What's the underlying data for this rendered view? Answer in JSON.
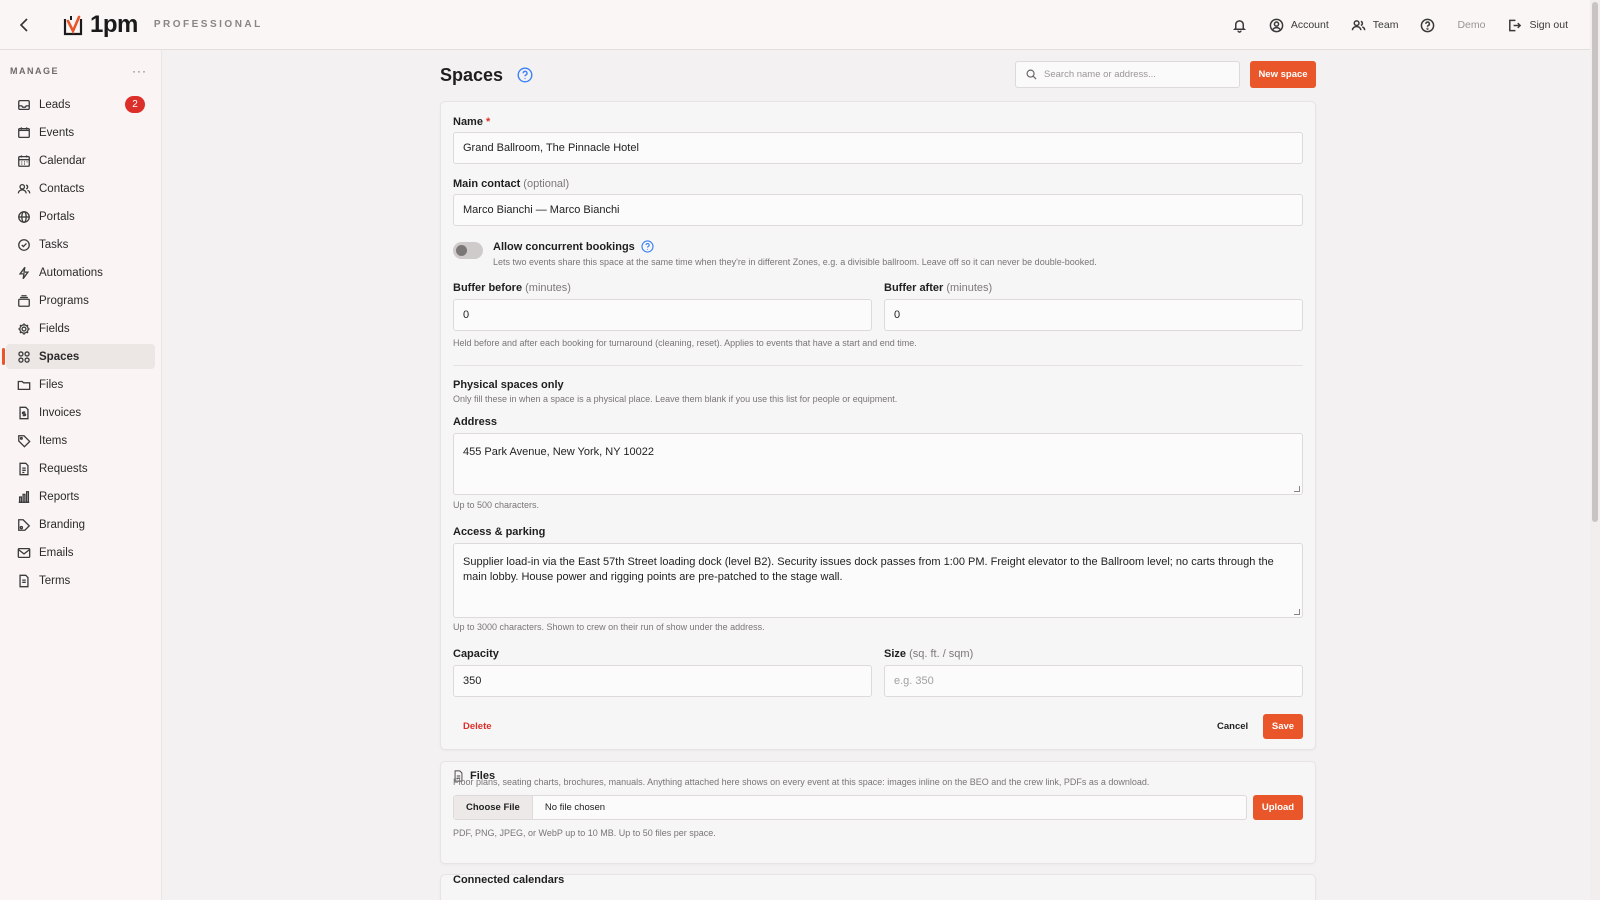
{
  "app": {
    "brand": "1pm",
    "tier": "PROFESSIONAL"
  },
  "topnav": {
    "account": "Account",
    "team": "Team",
    "demo": "Demo",
    "sign_out": "Sign out"
  },
  "sidebar": {
    "section": "MANAGE",
    "more": "···",
    "items": [
      {
        "label": "Leads",
        "icon": "inbox-icon",
        "badge": "2"
      },
      {
        "label": "Events",
        "icon": "mail-icon"
      },
      {
        "label": "Calendar",
        "icon": "calendar-icon"
      },
      {
        "label": "Contacts",
        "icon": "users-icon"
      },
      {
        "label": "Portals",
        "icon": "globe-icon"
      },
      {
        "label": "Tasks",
        "icon": "check-circle-icon"
      },
      {
        "label": "Automations",
        "icon": "bolt-icon"
      },
      {
        "label": "Programs",
        "icon": "layers-icon"
      },
      {
        "label": "Fields",
        "icon": "gear-icon"
      },
      {
        "label": "Spaces",
        "icon": "grid-icon",
        "active": true
      },
      {
        "label": "Files",
        "icon": "folder-icon"
      },
      {
        "label": "Invoices",
        "icon": "invoice-icon"
      },
      {
        "label": "Items",
        "icon": "tag-icon"
      },
      {
        "label": "Requests",
        "icon": "document-icon"
      },
      {
        "label": "Reports",
        "icon": "bar-chart-icon"
      },
      {
        "label": "Branding",
        "icon": "brush-icon"
      },
      {
        "label": "Emails",
        "icon": "envelope-icon"
      },
      {
        "label": "Terms",
        "icon": "file-text-icon"
      }
    ]
  },
  "page": {
    "title": "Spaces",
    "search_placeholder": "Search name or address...",
    "new_space": "New space"
  },
  "form": {
    "name_label": "Name",
    "required_mark": "*",
    "name_value": "Grand Ballroom, The Pinnacle Hotel",
    "contact_label": "Main contact",
    "contact_optional": "(optional)",
    "contact_value": "Marco Bianchi — Marco Bianchi",
    "concurrent_label": "Allow concurrent bookings",
    "concurrent_on": false,
    "concurrent_hint": "Lets two events share this space at the same time when they're in different Zones, e.g. a divisible ballroom. Leave off so it can never be double-booked.",
    "buffer_before_label": "Buffer before",
    "buffer_before_unit": "(minutes)",
    "buffer_before_value": "0",
    "buffer_after_label": "Buffer after",
    "buffer_after_unit": "(minutes)",
    "buffer_after_value": "0",
    "buffer_hint": "Held before and after each booking for turnaround (cleaning, reset). Applies to events that have a start and end time.",
    "physical_title": "Physical spaces only",
    "physical_hint": "Only fill these in when a space is a physical place. Leave them blank if you use this list for people or equipment.",
    "address_label": "Address",
    "address_value": "455 Park Avenue, New York, NY 10022",
    "address_hint": "Up to 500 characters.",
    "access_label": "Access & parking",
    "access_value": "Supplier load-in via the East 57th Street loading dock (level B2). Security issues dock passes from 1:00 PM. Freight elevator to the Ballroom level; no carts through the main lobby. House power and rigging points are pre-patched to the stage wall.",
    "access_hint": "Up to 3000 characters. Shown to crew on their run of show under the address.",
    "capacity_label": "Capacity",
    "capacity_value": "350",
    "size_label": "Size",
    "size_unit": "(sq. ft. / sqm)",
    "size_placeholder": "e.g. 350",
    "delete": "Delete",
    "cancel": "Cancel",
    "save": "Save"
  },
  "files": {
    "title": "Files",
    "description": "Floor plans, seating charts, brochures, manuals. Anything attached here shows on every event at this space: images inline on the BEO and the crew link, PDFs as a download.",
    "choose": "Choose File",
    "status": "No file chosen",
    "upload": "Upload",
    "hint": "PDF, PNG, JPEG, or WebP up to 10 MB. Up to 50 files per space."
  },
  "calendars": {
    "title": "Connected calendars"
  },
  "colors": {
    "accent": "#e8562a",
    "danger": "#dc2f2a",
    "help": "#3b82f6"
  }
}
